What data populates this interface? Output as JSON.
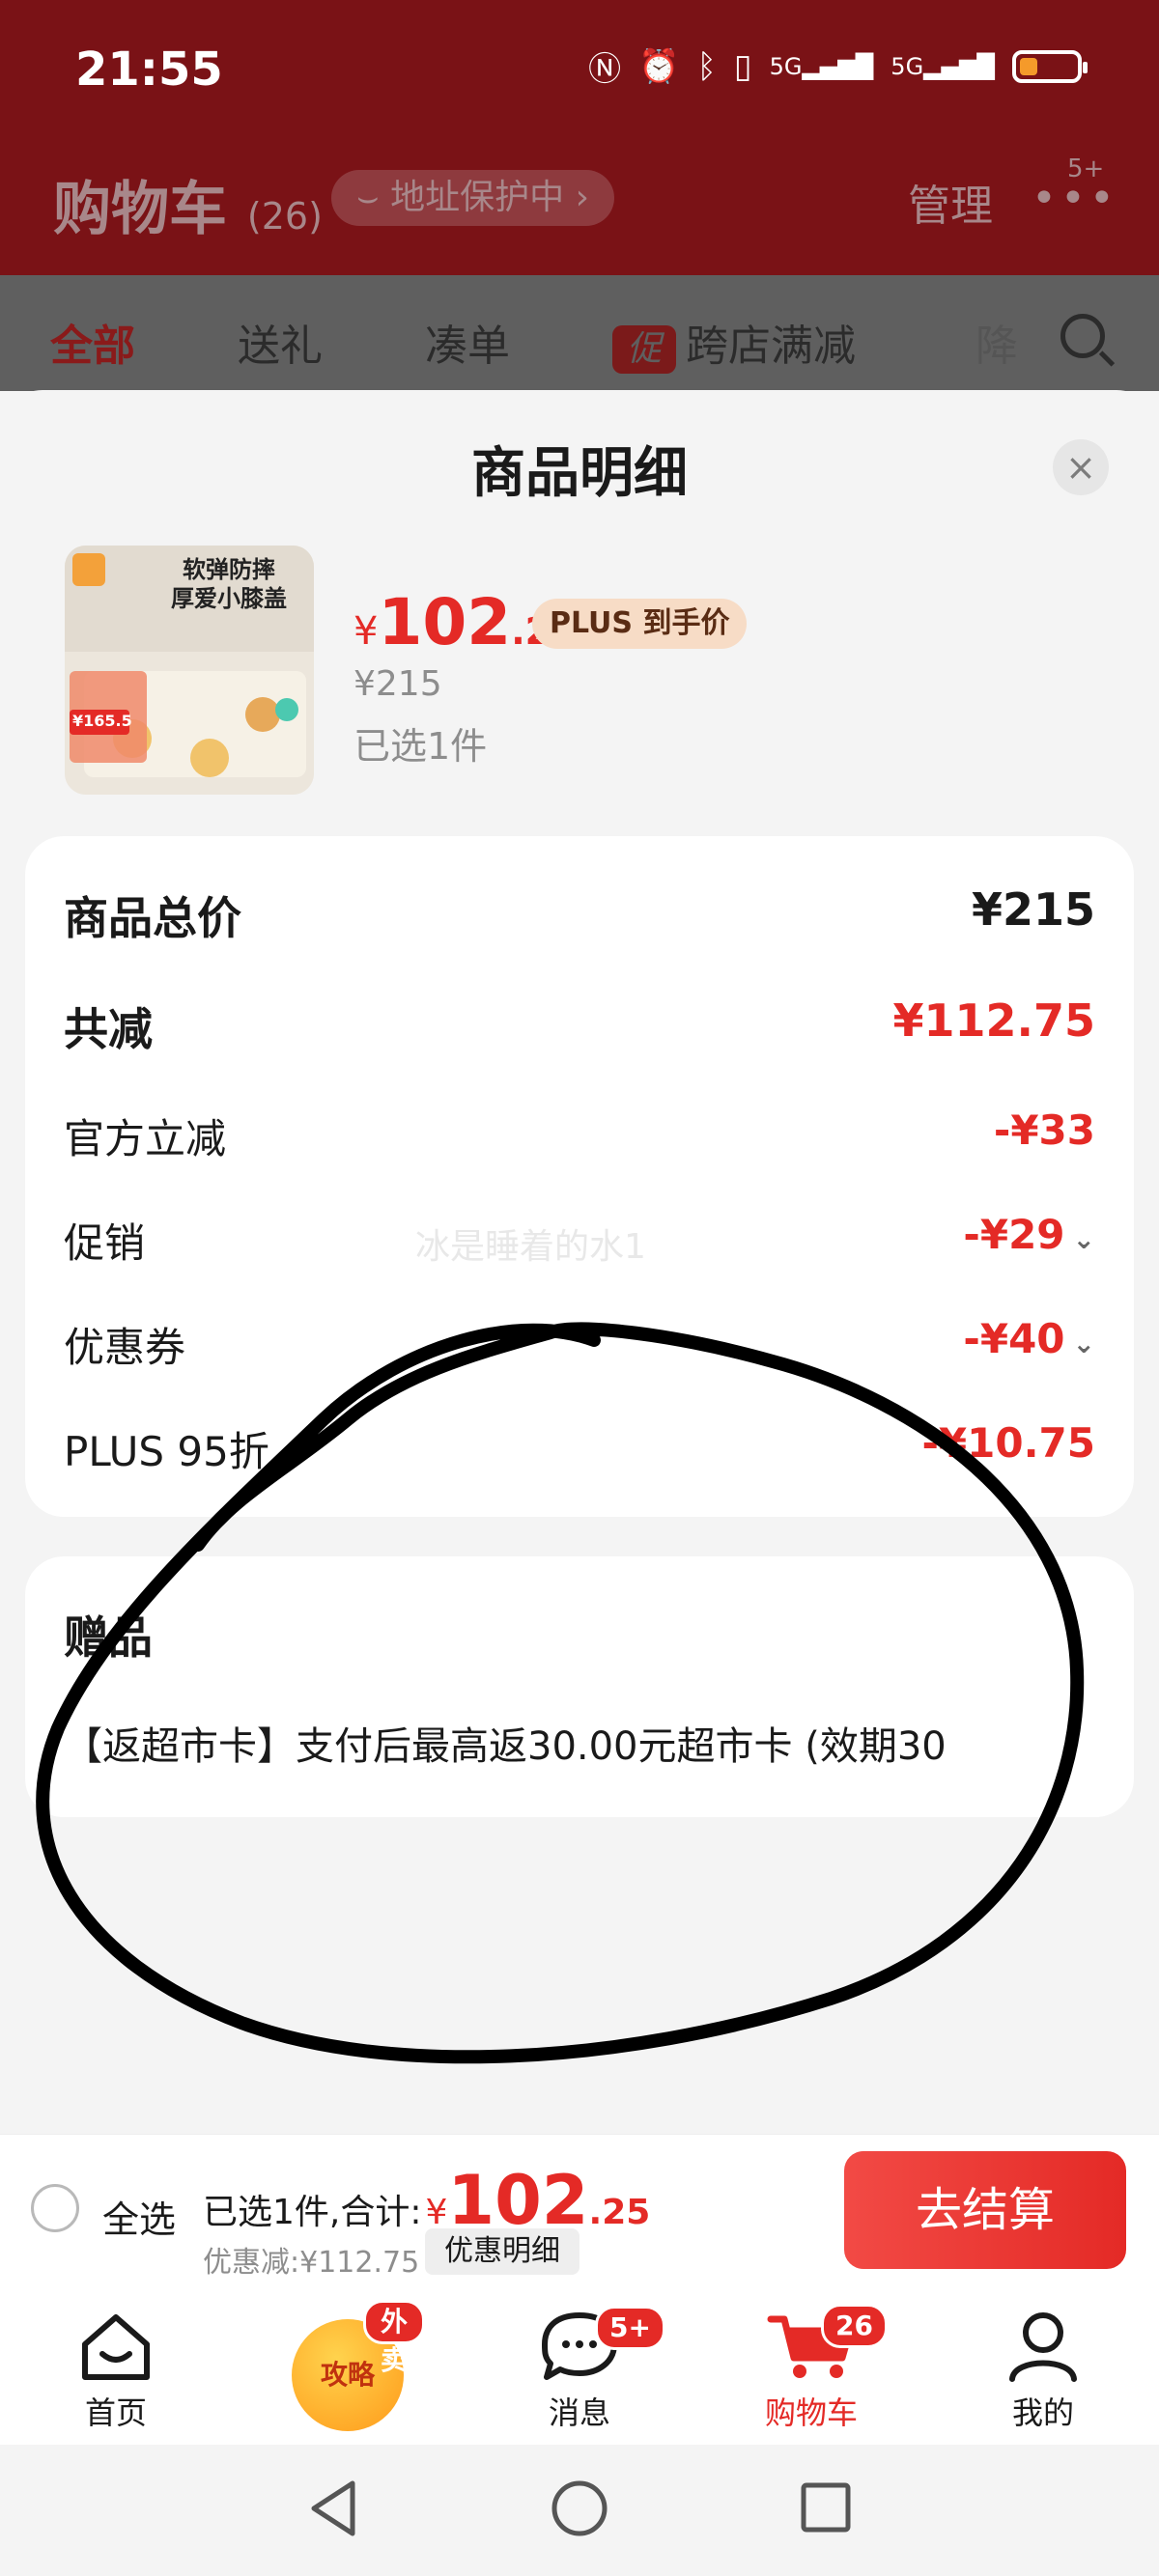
{
  "status_bar": {
    "time": "21:55",
    "icons": [
      "nfc-icon",
      "alarm-icon",
      "bluetooth-icon",
      "vibrate-icon",
      "signal-5g-icon",
      "signal-5g-icon",
      "battery-icon"
    ]
  },
  "header": {
    "title": "购物车",
    "count": "(26)",
    "address_pill": "地址保护中 ›",
    "manage_label": "管理",
    "more_badge": "5+"
  },
  "tabs": [
    {
      "label": "全部",
      "active": true
    },
    {
      "label": "送礼"
    },
    {
      "label": "凑单"
    },
    {
      "label": "跨店满减",
      "tag": "促"
    },
    {
      "label": "降"
    }
  ],
  "sheet": {
    "title": "商品明细",
    "close_label": "×"
  },
  "product": {
    "thumb_text_1": "软弹防摔",
    "thumb_text_2": "厚爱小膝盖",
    "thumb_price": "¥165.5",
    "price_currency": "¥",
    "price_int": "102",
    "price_dec": ".25",
    "plus_badge": "PLUS 到手价",
    "original_price": "¥215",
    "selected_qty": "已选1件"
  },
  "price_breakdown": {
    "total_label": "商品总价",
    "total_value": "¥215",
    "reduced_label": "共减",
    "reduced_value": "¥112.75",
    "rows": [
      {
        "label": "官方立减",
        "value": "-¥33",
        "chevron": false
      },
      {
        "label": "促销",
        "value": "-¥29",
        "chevron": true
      },
      {
        "label": "优惠券",
        "value": "-¥40",
        "chevron": true
      },
      {
        "label": "PLUS 95折",
        "value": "-¥10.75",
        "chevron": false
      }
    ]
  },
  "watermark": "冰是睡着的水1",
  "gift": {
    "title": "赠品",
    "text": "【返超市卡】支付后最高返30.00元超市卡 (效期30"
  },
  "checkout": {
    "select_all": "全选",
    "summary_label": "已选1件,合计:",
    "currency": "¥",
    "total_int": "102",
    "total_dec": ".25",
    "discount_text": "优惠减:¥112.75",
    "detail_button": "优惠明细",
    "checkout_button": "去结算"
  },
  "bottom_nav": [
    {
      "label": "首页",
      "icon": "home-icon"
    },
    {
      "label": "攻略",
      "icon": "guide-icon",
      "badge": "外卖"
    },
    {
      "label": "消息",
      "icon": "message-icon",
      "badge": "5+"
    },
    {
      "label": "购物车",
      "icon": "cart-icon",
      "badge": "26",
      "active": true
    },
    {
      "label": "我的",
      "icon": "profile-icon"
    }
  ],
  "colors": {
    "accent_red": "#e42a26",
    "header_dim": "#7a1216",
    "plus_badge_bg": "#f7dcc6"
  }
}
